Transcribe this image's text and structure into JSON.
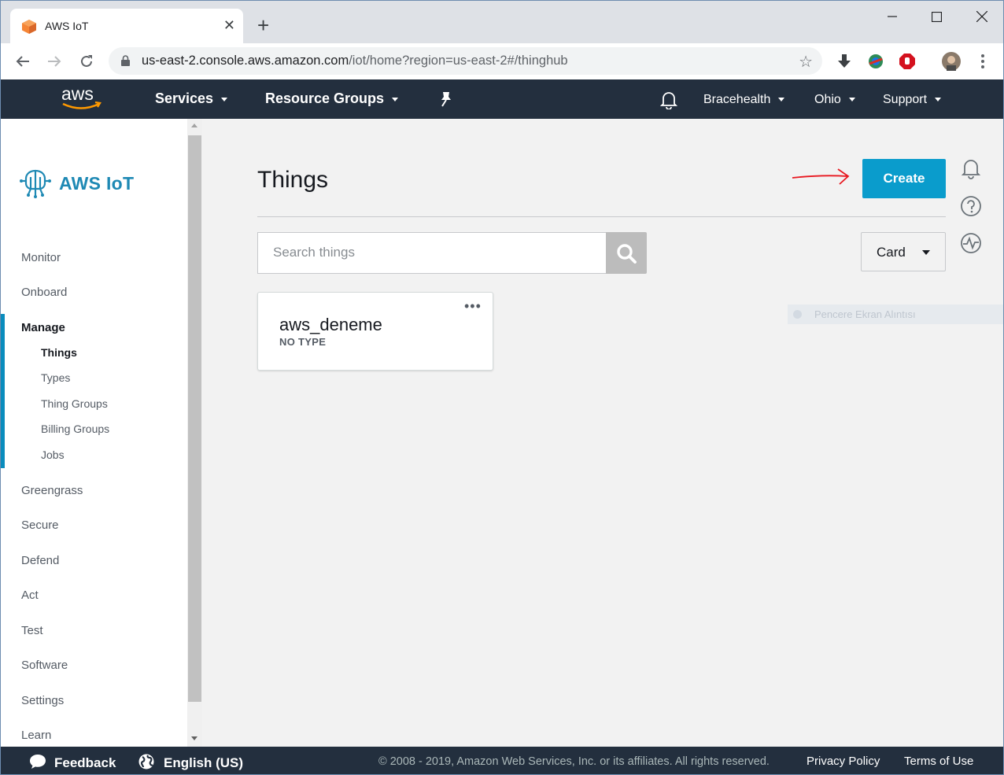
{
  "browser": {
    "tab_title": "AWS IoT",
    "url_host": "us-east-2.console.aws.amazon.com",
    "url_path": "/iot/home?region=us-east-2#/thinghub"
  },
  "aws_header": {
    "services_label": "Services",
    "resource_groups_label": "Resource Groups",
    "account_label": "Bracehealth",
    "region_label": "Ohio",
    "support_label": "Support"
  },
  "sidebar": {
    "brand": "AWS IoT",
    "items": [
      {
        "label": "Monitor"
      },
      {
        "label": "Onboard"
      },
      {
        "label": "Manage",
        "active": true
      },
      {
        "label": "Greengrass"
      },
      {
        "label": "Secure"
      },
      {
        "label": "Defend"
      },
      {
        "label": "Act"
      },
      {
        "label": "Test"
      },
      {
        "label": "Software"
      },
      {
        "label": "Settings"
      },
      {
        "label": "Learn"
      }
    ],
    "manage_sub": [
      {
        "label": "Things",
        "active": true
      },
      {
        "label": "Types"
      },
      {
        "label": "Thing Groups"
      },
      {
        "label": "Billing Groups"
      },
      {
        "label": "Jobs"
      }
    ]
  },
  "main": {
    "title": "Things",
    "create_label": "Create",
    "search_placeholder": "Search things",
    "view_mode": "Card",
    "things": [
      {
        "name": "aws_deneme",
        "type": "NO TYPE"
      }
    ],
    "overlay_text": "Pencere Ekran Alıntısı"
  },
  "footer": {
    "feedback_label": "Feedback",
    "language_label": "English (US)",
    "copyright": "© 2008 - 2019, Amazon Web Services, Inc. or its affiliates. All rights reserved.",
    "privacy_label": "Privacy Policy",
    "terms_label": "Terms of Use"
  },
  "colors": {
    "aws_nav": "#232f3e",
    "accent": "#0a9ccc",
    "annotation_arrow": "#e8171f"
  }
}
